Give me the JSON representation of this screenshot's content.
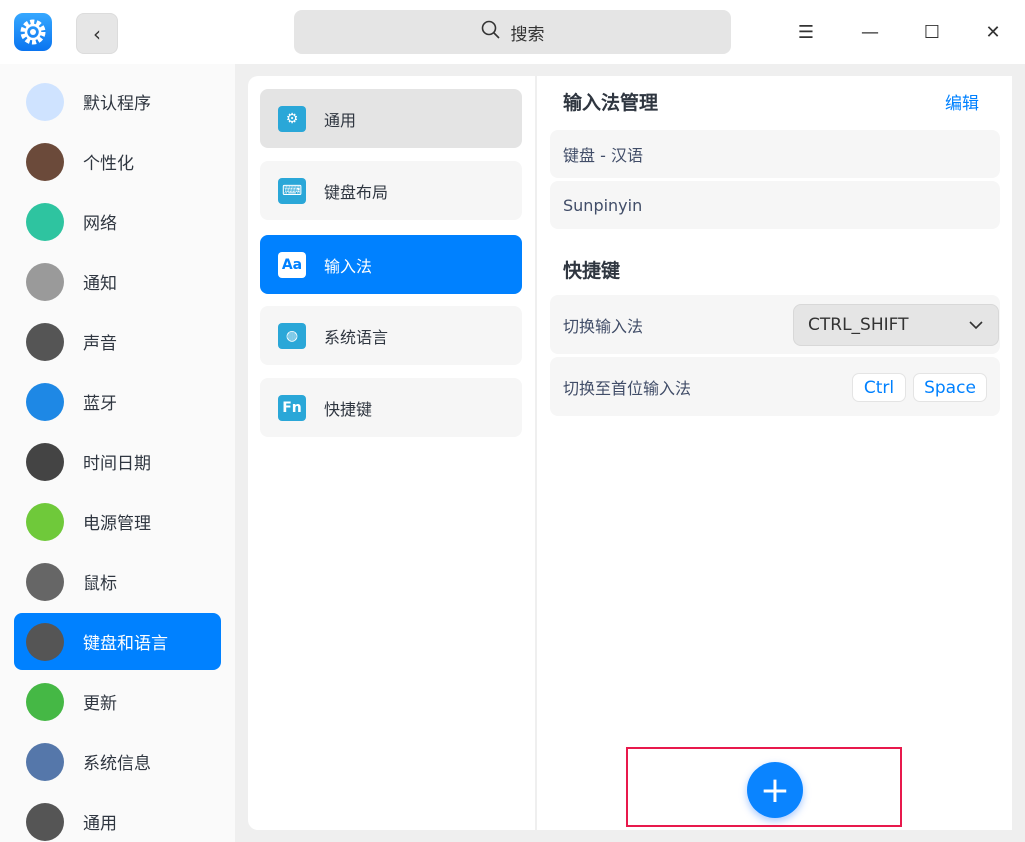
{
  "titlebar": {
    "search_placeholder": "搜索",
    "back_label": "‹",
    "menu_icon": "☰",
    "minimize_icon": "—",
    "maximize_icon": "☐",
    "close_icon": "✕"
  },
  "sidebar": {
    "items": [
      {
        "label": "默认程序",
        "icon": "default-apps-icon",
        "color": "#cfe3ff"
      },
      {
        "label": "个性化",
        "icon": "palette-icon",
        "color": "#6b4a3a"
      },
      {
        "label": "网络",
        "icon": "network-globe-icon",
        "color": "#2ec4a0"
      },
      {
        "label": "通知",
        "icon": "bell-icon",
        "color": "#9a9a9a"
      },
      {
        "label": "声音",
        "icon": "speaker-icon",
        "color": "#555"
      },
      {
        "label": "蓝牙",
        "icon": "bluetooth-icon",
        "color": "#1e88e5"
      },
      {
        "label": "时间日期",
        "icon": "clock-icon",
        "color": "#444"
      },
      {
        "label": "电源管理",
        "icon": "battery-icon",
        "color": "#6fc93a"
      },
      {
        "label": "鼠标",
        "icon": "mouse-icon",
        "color": "#666"
      },
      {
        "label": "键盘和语言",
        "icon": "keyboard-icon",
        "color": "#555",
        "selected": true
      },
      {
        "label": "更新",
        "icon": "update-arrow-icon",
        "color": "#45b845"
      },
      {
        "label": "系统信息",
        "icon": "system-info-icon",
        "color": "#5577aa"
      },
      {
        "label": "通用",
        "icon": "general-gear-icon",
        "color": "#555"
      }
    ]
  },
  "middle": {
    "items": [
      {
        "label": "通用",
        "icon": "gear-icon",
        "glyph": "⚙"
      },
      {
        "label": "键盘布局",
        "icon": "keyboard-layout-icon",
        "glyph": "⌨"
      },
      {
        "label": "输入法",
        "icon": "input-method-icon",
        "glyph": "Aa"
      },
      {
        "label": "系统语言",
        "icon": "globe-icon",
        "glyph": "◍"
      },
      {
        "label": "快捷键",
        "icon": "fn-icon",
        "glyph": "Fn"
      }
    ]
  },
  "main": {
    "im_title": "输入法管理",
    "edit_label": "编辑",
    "input_methods": [
      "键盘 - 汉语",
      "Sunpinyin"
    ],
    "shortcut_title": "快捷键",
    "switch_label": "切换输入法",
    "switch_value": "CTRL_SHIFT",
    "first_label": "切换至首位输入法",
    "first_keys": [
      "Ctrl",
      "Space"
    ],
    "add_label": "+"
  }
}
